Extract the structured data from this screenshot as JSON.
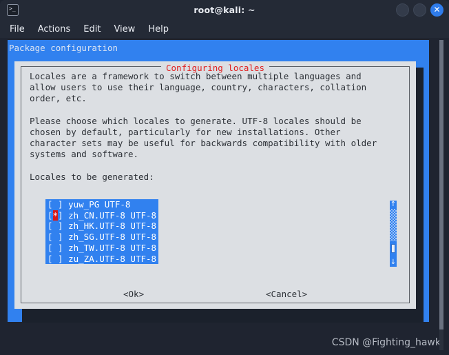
{
  "window": {
    "title": "root@kali: ~",
    "app_icon": "terminal-icon",
    "prompt_glyph": "&gt;_",
    "buttons": {
      "minimize": "minimize",
      "maximize": "maximize",
      "close": "✕"
    }
  },
  "menubar": {
    "items": [
      {
        "label": "File",
        "name": "menu-file"
      },
      {
        "label": "Actions",
        "name": "menu-actions"
      },
      {
        "label": "Edit",
        "name": "menu-edit"
      },
      {
        "label": "View",
        "name": "menu-view"
      },
      {
        "label": "Help",
        "name": "menu-help"
      }
    ]
  },
  "terminal": {
    "backdrop_title": "Package configuration",
    "backdrop_color": "#3181ef"
  },
  "dialog": {
    "legend": "Configuring locales",
    "legend_color": "#e02020",
    "paragraphs": "Locales are a framework to switch between multiple languages and\nallow users to use their language, country, characters, collation\norder, etc.\n\nPlease choose which locales to generate. UTF-8 locales should be\nchosen by default, particularly for new installations. Other\ncharacter sets may be useful for backwards compatibility with older\nsystems and software.\n\nLocales to be generated:",
    "list": [
      {
        "mark": " ",
        "label": "yuw_PG UTF-8",
        "selected": false
      },
      {
        "mark": "*",
        "label": "zh_CN.UTF-8 UTF-8",
        "selected": true
      },
      {
        "mark": " ",
        "label": "zh_HK.UTF-8 UTF-8",
        "selected": false
      },
      {
        "mark": " ",
        "label": "zh_SG.UTF-8 UTF-8",
        "selected": false
      },
      {
        "mark": " ",
        "label": "zh_TW.UTF-8 UTF-8",
        "selected": false
      },
      {
        "mark": " ",
        "label": "zu_ZA.UTF-8 UTF-8",
        "selected": false
      }
    ],
    "scrollbar": {
      "up_arrow": "↑",
      "down_arrow": "↓"
    },
    "buttons": {
      "ok": "<Ok>",
      "cancel": "<Cancel>"
    }
  },
  "watermark": {
    "text": "CSDN @Fighting_hawk"
  }
}
